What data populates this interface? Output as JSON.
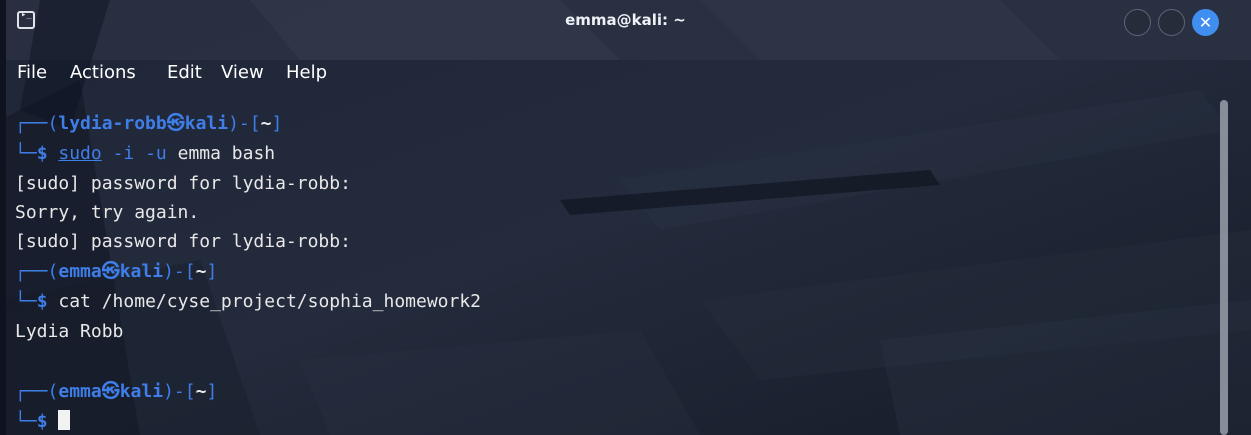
{
  "window": {
    "title": "emma@kali: ~",
    "app_icon": "terminal-icon",
    "controls": {
      "minimize_icon": "circle-icon",
      "maximize_icon": "circle-icon",
      "close_glyph": "✕",
      "close_color": "#3f8ef0"
    }
  },
  "menubar": {
    "items": [
      "File",
      "Actions",
      "Edit",
      "View",
      "Help"
    ]
  },
  "terminal": {
    "prompt1": {
      "corner_top": "┌──",
      "open_paren": "(",
      "user": "lydia-robb",
      "at_symbol": "㉿",
      "host": "kali",
      "close_paren": ")-[",
      "dir": "~",
      "close_bracket": "]",
      "corner_bottom": "└─",
      "dollar": "$",
      "cmd_sudo": "sudo",
      "cmd_args": "-i -u",
      "cmd_rest": "emma bash"
    },
    "output1": [
      "[sudo] password for lydia-robb:",
      "Sorry, try again.",
      "[sudo] password for lydia-robb:"
    ],
    "prompt2": {
      "corner_top": "┌──",
      "open_paren": "(",
      "user": "emma",
      "at_symbol": "㉿",
      "host": "kali",
      "close_paren": ")-[",
      "dir": "~",
      "close_bracket": "]",
      "corner_bottom": "└─",
      "dollar": "$",
      "command": "cat /home/cyse_project/sophia_homework2"
    },
    "output2": "Lydia Robb",
    "prompt3": {
      "corner_top": "┌──",
      "open_paren": "(",
      "user": "emma",
      "at_symbol": "㉿",
      "host": "kali",
      "close_paren": ")-[",
      "dir": "~",
      "close_bracket": "]",
      "corner_bottom": "└─",
      "dollar": "$"
    },
    "colors": {
      "prompt_accent": "#3f7ee8",
      "text": "#e8e8e8",
      "background": "#1b2130"
    }
  }
}
